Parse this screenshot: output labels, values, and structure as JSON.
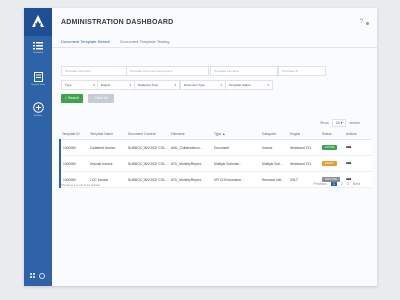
{
  "app": {
    "title": "ADMINISTRATION DASHBOARD",
    "help": "?"
  },
  "sidebar": {
    "items": [
      {
        "label": "Dashboard",
        "icon": "list-icon"
      },
      {
        "label": "Template Tester",
        "icon": "template-icon"
      },
      {
        "label": "Add New",
        "icon": "add-icon"
      }
    ]
  },
  "tabs": [
    {
      "label": "Document Template Search",
      "active": true
    },
    {
      "label": "Document Template Testing",
      "active": false
    }
  ],
  "filters": {
    "inputs": [
      {
        "placeholder": "Template Id/Version"
      },
      {
        "placeholder": "Template Document Description"
      },
      {
        "placeholder": "Template Filename"
      },
      {
        "placeholder": "Template ID"
      }
    ],
    "selects": [
      {
        "value": "Type"
      },
      {
        "value": "Engine"
      },
      {
        "value": "Datapoint Type"
      },
      {
        "value": "Document Type"
      },
      {
        "value": "Template Status"
      }
    ],
    "search_label": "Search",
    "clear_label": "Clear All"
  },
  "pagination": {
    "show_label": "Show",
    "page_size": "10",
    "entries_label": "entries",
    "summary": "Showing 1 to 10 of 12 entries",
    "prev": "Previous",
    "pages": [
      "1",
      "2",
      "3"
    ],
    "next": "Next"
  },
  "table": {
    "columns": [
      "Template ID",
      "Template Name",
      "Document Content",
      "Filename",
      "Type",
      "Datapoint",
      "Engine",
      "Status",
      "Actions"
    ],
    "rows": [
      {
        "id": "1000060",
        "name": "Collateral Invoice",
        "content": "SUBDOC_INVOICE COL...",
        "filename": "AML_CollateralInvo...",
        "type": "Document",
        "datapoint": "Invoice",
        "engine": "Windward V11",
        "status": "ACTIVE",
        "status_color": "#3fa34d"
      },
      {
        "id": "1000060",
        "name": "Deposit Invoice",
        "content": "SUBDOC_INVOICE COL...",
        "filename": "ATU_MonthlyReport...",
        "type": "Multiple Submiss...",
        "datapoint": "Multiple Sub...",
        "engine": "Windward V11",
        "status": "DRAFT",
        "status_color": "#e3a02c"
      },
      {
        "id": "1000060",
        "name": "LOC Invoice",
        "content": "SUBDOC_INVOICE COL...",
        "filename": "ATU_MonthlyReport...",
        "type": "VFI Gl Endorseme...",
        "datapoint": "Renewal Lett...",
        "engine": "XSLT",
        "status": "INACTIVE",
        "status_color": "#8a8f96"
      }
    ]
  },
  "colors": {
    "accent": "#2f63a8",
    "sidebar": "#2f63a8",
    "success": "#3fa34d"
  }
}
